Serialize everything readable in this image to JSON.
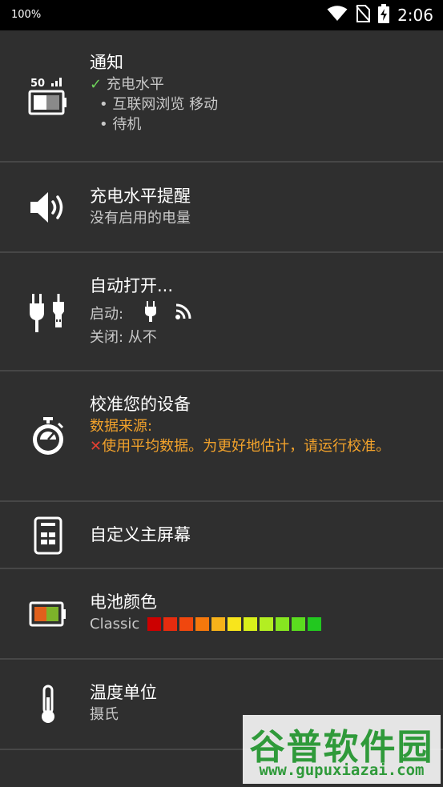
{
  "status_bar": {
    "battery_percent_label": "100%",
    "time": "2:06"
  },
  "rows": {
    "notification": {
      "title": "通知",
      "icon_label": "50",
      "check_mark": "✓",
      "line1": "充电水平",
      "bullet_glyph": "•",
      "bullet1": "互联网浏览 移动",
      "bullet2": "待机"
    },
    "charge_reminder": {
      "title": "充电水平提醒",
      "subtitle": "没有启用的电量"
    },
    "auto_open": {
      "title": "自动打开...",
      "start_label": "启动:",
      "close_label": "关闭: 从不"
    },
    "calibrate": {
      "title": "校准您的设备",
      "source_label": "数据来源:",
      "x_mark": "✕",
      "warning": "使用平均数据。为更好地估计，请运行校准。"
    },
    "home_screen": {
      "title": "自定义主屏幕"
    },
    "battery_color": {
      "title": "电池颜色",
      "scheme": "Classic",
      "swatches": [
        "#cc0000",
        "#e62c0f",
        "#f0470e",
        "#f5780c",
        "#f7b21a",
        "#f8e51c",
        "#d8f01a",
        "#b3ee22",
        "#86e620",
        "#5bdc1f",
        "#22c81f"
      ]
    },
    "temperature": {
      "title": "温度单位",
      "subtitle": "摄氏"
    }
  },
  "watermark": {
    "brand": "谷普软件园",
    "url": "www.gupuxiazai.com"
  }
}
